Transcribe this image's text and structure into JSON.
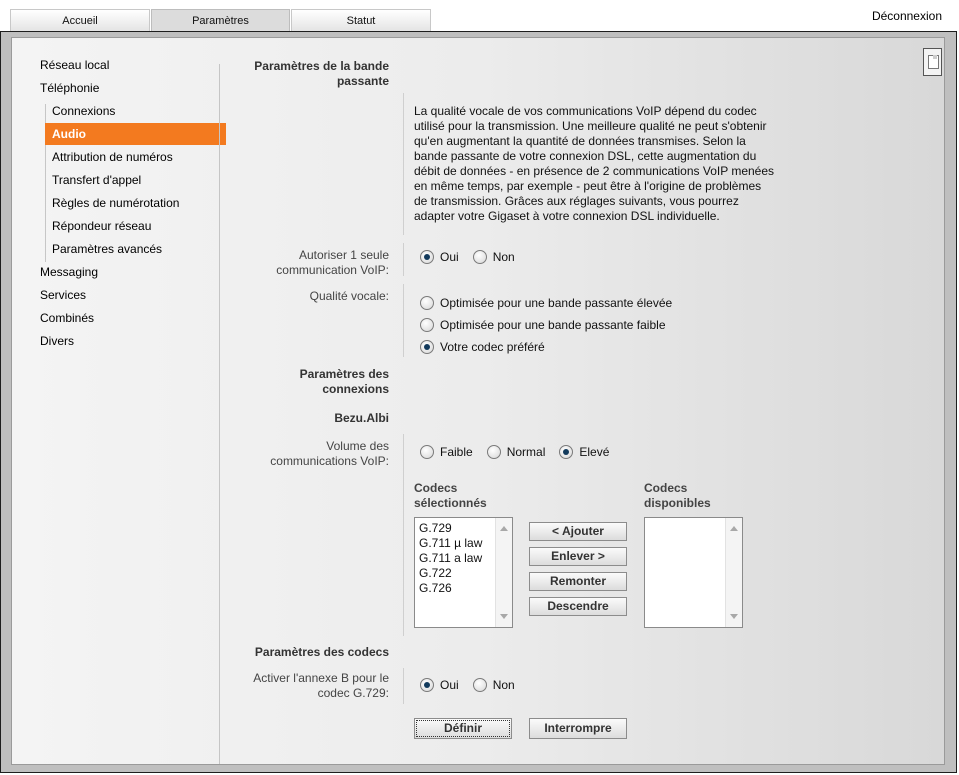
{
  "tabs": [
    {
      "label": "Accueil"
    },
    {
      "label": "Paramètres"
    },
    {
      "label": "Statut"
    }
  ],
  "logout_label": "Déconnexion",
  "nav": {
    "items": [
      {
        "label": "Réseau local"
      },
      {
        "label": "Téléphonie"
      },
      {
        "label": "Connexions"
      },
      {
        "label": "Audio"
      },
      {
        "label": "Attribution de numéros"
      },
      {
        "label": "Transfert d'appel"
      },
      {
        "label": "Règles de numérotation"
      },
      {
        "label": "Répondeur réseau"
      },
      {
        "label": "Paramètres avancés"
      },
      {
        "label": "Messaging"
      },
      {
        "label": "Services"
      },
      {
        "label": "Combinés"
      },
      {
        "label": "Divers"
      }
    ],
    "selected": "Audio"
  },
  "bandwidth": {
    "header_line1": "Paramètres de la bande",
    "header_line2": "passante",
    "description": "La qualité vocale de vos communications VoIP dépend du codec utilisé pour la transmission. Une meilleure qualité ne peut s'obtenir qu'en augmentant la quantité de données transmises. Selon la bande passante de votre connexion DSL, cette augmentation du débit de données - en présence de 2 communications VoIP menées en même temps, par exemple - peut être à l'origine de problèmes de transmission. Grâces aux réglages suivants, vous pourrez adapter votre Gigaset à votre connexion DSL individuelle.",
    "allow_single_label_line1": "Autoriser 1 seule",
    "allow_single_label_line2": "communication VoIP:",
    "allow_single_options": [
      "Oui",
      "Non"
    ],
    "allow_single_selected": "Oui",
    "voice_quality_label": "Qualité vocale:",
    "voice_quality_options": [
      "Optimisée pour une bande passante élevée",
      "Optimisée pour une bande passante faible",
      "Votre codec préféré"
    ],
    "voice_quality_selected": "Votre codec préféré"
  },
  "connections": {
    "header_line1": "Paramètres des",
    "header_line2": "connexions",
    "account_name": "Bezu.Albi",
    "volume_label_line1": "Volume des",
    "volume_label_line2": "communications VoIP:",
    "volume_options": [
      "Faible",
      "Normal",
      "Elevé"
    ],
    "volume_selected": "Elevé",
    "selected_codecs_header_line1": "Codecs",
    "selected_codecs_header_line2": "sélectionnés",
    "available_codecs_header_line1": "Codecs",
    "available_codecs_header_line2": "disponibles",
    "selected_codecs": [
      "G.729",
      "G.711 µ law",
      "G.711 a law",
      "G.722",
      "G.726"
    ],
    "available_codecs": [],
    "buttons": {
      "add": "< Ajouter",
      "remove": "Enlever >",
      "up": "Remonter",
      "down": "Descendre"
    }
  },
  "codecs": {
    "header": "Paramètres des codecs",
    "annex_b_label_line1": "Activer l'annexe B pour le",
    "annex_b_label_line2": "codec G.729:",
    "annex_b_options": [
      "Oui",
      "Non"
    ],
    "annex_b_selected": "Oui"
  },
  "actions": {
    "define": "Définir",
    "cancel": "Interrompre"
  },
  "colors": {
    "nav_selected_bg": "#f37a1f",
    "radio_dot": "#123a5c"
  },
  "icons": {
    "help": "help-page-icon"
  }
}
